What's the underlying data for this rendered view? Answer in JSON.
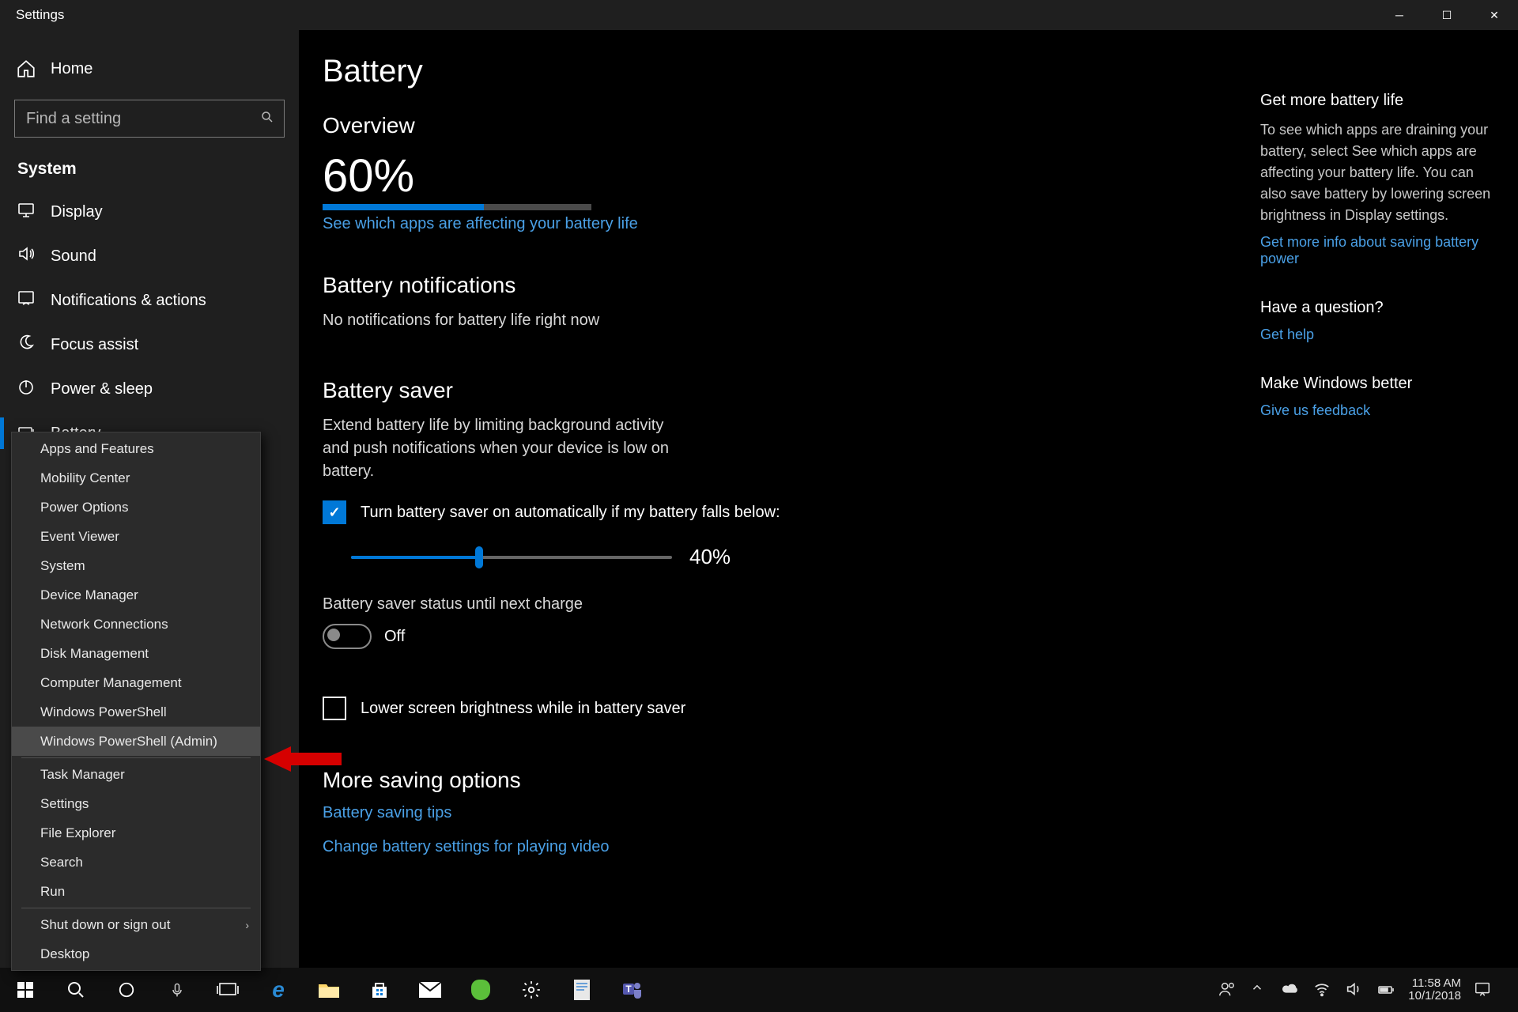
{
  "window": {
    "title": "Settings"
  },
  "sidebar": {
    "home": "Home",
    "search_placeholder": "Find a setting",
    "section": "System",
    "items": [
      {
        "label": "Display"
      },
      {
        "label": "Sound"
      },
      {
        "label": "Notifications & actions"
      },
      {
        "label": "Focus assist"
      },
      {
        "label": "Power & sleep"
      },
      {
        "label": "Battery"
      }
    ]
  },
  "page": {
    "title": "Battery",
    "overview": {
      "heading": "Overview",
      "percent": "60%",
      "percent_num": 60,
      "link": "See which apps are affecting your battery life"
    },
    "notifications": {
      "heading": "Battery notifications",
      "text": "No notifications for battery life right now"
    },
    "saver": {
      "heading": "Battery saver",
      "desc": "Extend battery life by limiting background activity and push notifications when your device is low on battery.",
      "cb_label": "Turn battery saver on automatically if my battery falls below:",
      "slider_percent": "40%",
      "slider_num": 40,
      "status_label": "Battery saver status until next charge",
      "toggle_text": "Off",
      "brightness_label": "Lower screen brightness while in battery saver"
    },
    "more": {
      "heading": "More saving options",
      "link1": "Battery saving tips",
      "link2": "Change battery settings for playing video"
    }
  },
  "rpanel": {
    "r1h": "Get more battery life",
    "r1t": "To see which apps are draining your battery, select See which apps are affecting your battery life. You can also save battery by lowering screen brightness in Display settings.",
    "r1l": "Get more info about saving battery power",
    "r2h": "Have a question?",
    "r2l": "Get help",
    "r3h": "Make Windows better",
    "r3l": "Give us feedback"
  },
  "ctx": {
    "items1": [
      "Apps and Features",
      "Mobility Center",
      "Power Options",
      "Event Viewer",
      "System",
      "Device Manager",
      "Network Connections",
      "Disk Management",
      "Computer Management",
      "Windows PowerShell",
      "Windows PowerShell (Admin)"
    ],
    "items2": [
      "Task Manager",
      "Settings",
      "File Explorer",
      "Search",
      "Run"
    ],
    "items3": [
      "Shut down or sign out",
      "Desktop"
    ],
    "highlighted": "Windows PowerShell (Admin)"
  },
  "tray": {
    "time": "11:58 AM",
    "date": "10/1/2018"
  }
}
